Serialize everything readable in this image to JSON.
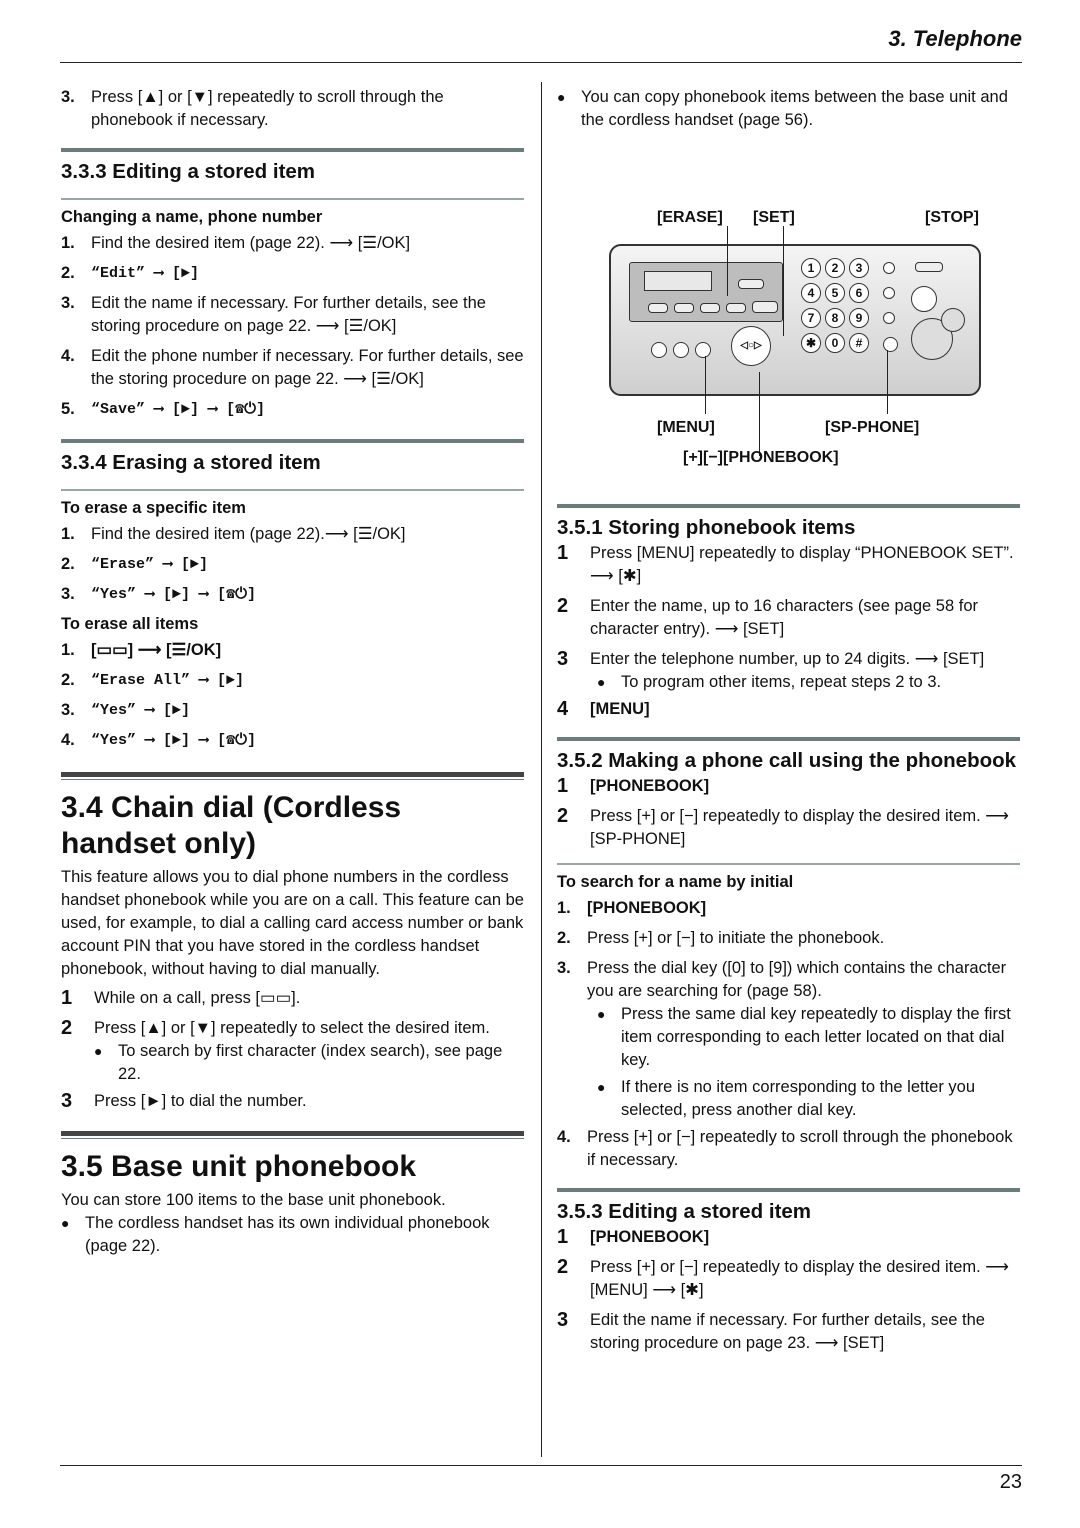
{
  "header": {
    "running_title": "3. Telephone"
  },
  "footer": {
    "page_number": "23"
  },
  "left": {
    "intro_step": {
      "num": "3.",
      "text": "Press [▲] or [▼] repeatedly to scroll through the phonebook if necessary."
    },
    "s333": {
      "title": "3.3.3 Editing a stored item",
      "subhead": "Changing a name, phone number",
      "steps": [
        {
          "num": "1.",
          "text": "Find the desired item (page 22). ⟶ [☰/OK]"
        },
        {
          "num": "2.",
          "text": "“Edit” ⟶ [►]"
        },
        {
          "num": "3.",
          "text": "Edit the name if necessary. For further details, see the storing procedure on page 22. ⟶ [☰/OK]"
        },
        {
          "num": "4.",
          "text": "Edit the phone number if necessary. For further details, see the storing procedure on page 22. ⟶ [☰/OK]"
        },
        {
          "num": "5.",
          "text": "“Save” ⟶ [►] ⟶ [☎⏻]"
        }
      ]
    },
    "s334": {
      "title": "3.3.4 Erasing a stored item",
      "subhead_specific": "To erase a specific item",
      "steps_specific": [
        {
          "num": "1.",
          "text": "Find the desired item (page 22).⟶ [☰/OK]"
        },
        {
          "num": "2.",
          "text": "“Erase” ⟶ [►]"
        },
        {
          "num": "3.",
          "text": "“Yes” ⟶ [►] ⟶ [☎⏻]"
        }
      ],
      "subhead_all": "To erase all items",
      "steps_all": [
        {
          "num": "1.",
          "text": "[▭▭] ⟶ [☰/OK]"
        },
        {
          "num": "2.",
          "text": "“Erase All” ⟶ [►]"
        },
        {
          "num": "3.",
          "text": "“Yes” ⟶ [►]"
        },
        {
          "num": "4.",
          "text": "“Yes” ⟶ [►] ⟶ [☎⏻]"
        }
      ]
    },
    "s34": {
      "title": "3.4 Chain dial (Cordless handset only)",
      "body": "This feature allows you to dial phone numbers in the cordless handset phonebook while you are on a call. This feature can be used, for example, to dial a calling card access number or bank account PIN that you have stored in the cordless handset phonebook, without having to dial manually.",
      "steps": [
        {
          "num": "1",
          "text": "While on a call, press [▭▭]."
        },
        {
          "num": "2",
          "text": "Press [▲] or [▼] repeatedly to select the desired item."
        },
        {
          "num": "3",
          "text": "Press [►] to dial the number."
        }
      ],
      "bullet": "To search by first character (index search), see page 22."
    },
    "s35": {
      "title": "3.5 Base unit phonebook",
      "body": "You can store 100 items to the base unit phonebook.",
      "bullet": "The cordless handset has its own individual phonebook (page 22)."
    }
  },
  "right": {
    "intro_bullet": "You can copy phonebook items between the base unit and the cordless handset (page 56).",
    "diagram": {
      "labels": {
        "erase": "[ERASE]",
        "set": "[SET]",
        "stop": "[STOP]",
        "menu": "[MENU]",
        "sp_phone": "[SP-PHONE]",
        "phonebook": "[+][−][PHONEBOOK]"
      },
      "keypad": [
        "1",
        "2",
        "3",
        "4",
        "5",
        "6",
        "7",
        "8",
        "9",
        "✱",
        "0",
        "#"
      ]
    },
    "s351": {
      "title": "3.5.1 Storing phonebook items",
      "steps": [
        {
          "num": "1",
          "text": "Press [MENU] repeatedly to display “PHONEBOOK SET”. ⟶ [✱]"
        },
        {
          "num": "2",
          "text": "Enter the name, up to 16 characters (see page 58 for character entry). ⟶ [SET]"
        },
        {
          "num": "3",
          "text": "Enter the telephone number, up to 24 digits. ⟶ [SET]"
        },
        {
          "num": "4",
          "text": "[MENU]"
        }
      ],
      "bullet": "To program other items, repeat steps 2 to 3."
    },
    "s352": {
      "title": "3.5.2 Making a phone call using the phonebook",
      "steps": [
        {
          "num": "1",
          "text": "[PHONEBOOK]"
        },
        {
          "num": "2",
          "text": "Press [+] or [−] repeatedly to display the desired item. ⟶ [SP-PHONE]"
        }
      ],
      "subhead": "To search for a name by initial",
      "search_steps": [
        {
          "num": "1.",
          "text": "[PHONEBOOK]"
        },
        {
          "num": "2.",
          "text": "Press [+] or [−] to initiate the phonebook."
        },
        {
          "num": "3.",
          "text": "Press the dial key ([0] to [9]) which contains the character you are searching for (page 58)."
        },
        {
          "num": "4.",
          "text": "Press [+] or [−] repeatedly to scroll through the phonebook if necessary."
        }
      ],
      "search_bullets": [
        "Press the same dial key repeatedly to display the first item corresponding to each letter located on that dial key.",
        "If there is no item corresponding to the letter you selected, press another dial key."
      ]
    },
    "s353": {
      "title": "3.5.3 Editing a stored item",
      "steps": [
        {
          "num": "1",
          "text": "[PHONEBOOK]"
        },
        {
          "num": "2",
          "text": "Press [+] or [−] repeatedly to display the desired item. ⟶ [MENU] ⟶ [✱]"
        },
        {
          "num": "3",
          "text": "Edit the name if necessary. For further details, see the storing procedure on page 23. ⟶ [SET]"
        }
      ]
    }
  }
}
